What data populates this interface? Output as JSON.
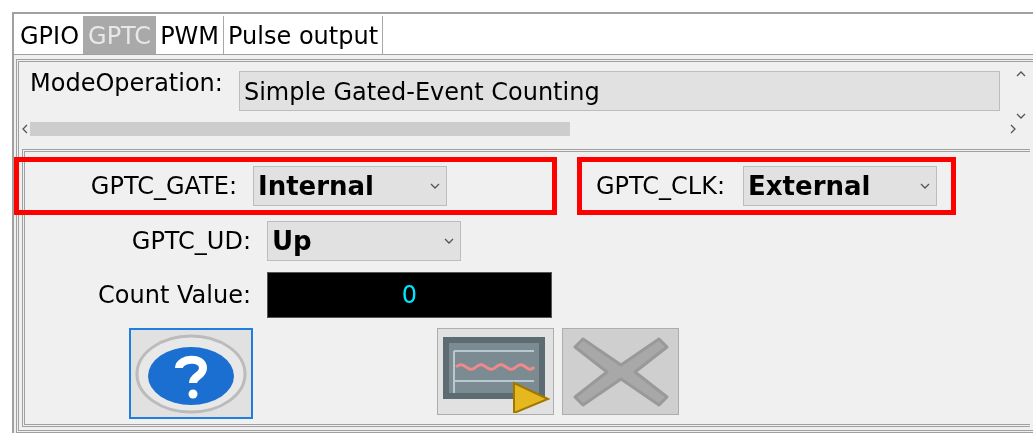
{
  "tabs": [
    {
      "label": "GPIO",
      "selected": false
    },
    {
      "label": "GPTC",
      "selected": true
    },
    {
      "label": "PWM",
      "selected": false
    },
    {
      "label": "Pulse output",
      "selected": false
    }
  ],
  "mode": {
    "label": "ModeOperation:",
    "value": "Simple Gated-Event Counting"
  },
  "gate": {
    "label": "GPTC_GATE:",
    "value": "Internal",
    "highlighted": true
  },
  "clk": {
    "label": "GPTC_CLK:",
    "value": "External",
    "highlighted": true
  },
  "ud": {
    "label": "GPTC_UD:",
    "value": "Up",
    "highlighted": false
  },
  "count": {
    "label": "Count Value:",
    "value": "0"
  },
  "buttons": [
    {
      "kind": "help",
      "focused": true,
      "disabled": false
    },
    {
      "kind": "chart",
      "focused": false,
      "disabled": false
    },
    {
      "kind": "cancel",
      "focused": false,
      "disabled": true
    }
  ]
}
